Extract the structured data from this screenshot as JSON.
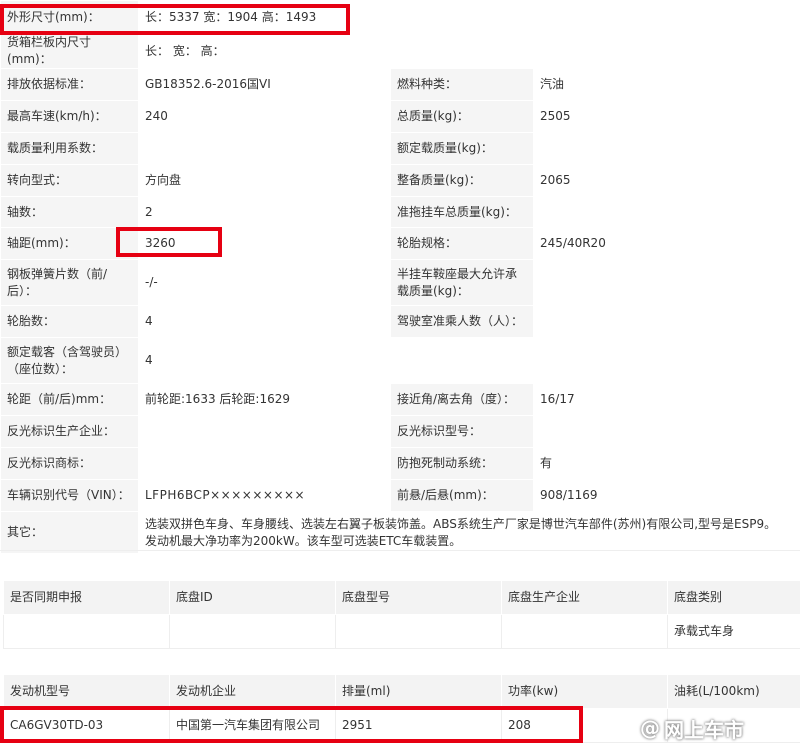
{
  "specs": [
    {
      "label": "外形尺寸(mm)：",
      "value": "长：5337 宽：1904 高：1493"
    },
    {
      "label": "货箱栏板内尺寸(mm)：",
      "value": "长： 宽： 高："
    },
    {
      "label": "排放依据标准：",
      "value": "GB18352.6-2016国VI",
      "label2": "燃料种类：",
      "value2": "汽油"
    },
    {
      "label": "最高车速(km/h)：",
      "value": "240",
      "label2": "总质量(kg)：",
      "value2": "2505"
    },
    {
      "label": "载质量利用系数：",
      "value": "",
      "label2": "额定载质量(kg)：",
      "value2": ""
    },
    {
      "label": "转向型式：",
      "value": "方向盘",
      "label2": "整备质量(kg)：",
      "value2": "2065"
    },
    {
      "label": "轴数：",
      "value": "2",
      "label2": "准拖挂车总质量(kg)：",
      "value2": ""
    },
    {
      "label": "轴距(mm)：",
      "value": "3260",
      "label2": "轮胎规格：",
      "value2": "245/40R20"
    },
    {
      "label": "钢板弹簧片数（前/后）：",
      "value": "-/-",
      "label2": "半挂车鞍座最大允许承载质量(kg)：",
      "value2": ""
    },
    {
      "label": "轮胎数：",
      "value": "4",
      "label2": "驾驶室准乘人数（人）：",
      "value2": ""
    },
    {
      "label": "额定载客（含驾驶员）（座位数）：",
      "value": "4"
    },
    {
      "label": "轮距（前/后)mm：",
      "value": "前轮距:1633 后轮距:1629",
      "label2": "接近角/离去角（度）：",
      "value2": "16/17"
    },
    {
      "label": "反光标识生产企业：",
      "value": "",
      "label2": "反光标识型号：",
      "value2": ""
    },
    {
      "label": "反光标识商标：",
      "value": "",
      "label2": "防抱死制动系统：",
      "value2": "有"
    },
    {
      "label": "车辆识别代号（VIN）：",
      "value": "LFPH6BCP×××××××××",
      "label2": "前悬/后悬(mm)：",
      "value2": "908/1169"
    },
    {
      "label": "其它：",
      "value": "选装双拼色车身、车身腰线、选装左右翼子板装饰盖。ABS系统生产厂家是博世汽车部件(苏州)有限公司,型号是ESP9。发动机最大净功率为200kW。该车型可选装ETC车载装置。"
    }
  ],
  "chassis": {
    "headers": [
      "是否同期申报",
      "底盘ID",
      "底盘型号",
      "底盘生产企业",
      "底盘类别"
    ],
    "row": [
      "",
      "",
      "",
      "",
      "承载式车身"
    ]
  },
  "engine": {
    "headers": [
      "发动机型号",
      "发动机企业",
      "排量(ml)",
      "功率(kw)",
      "油耗(L/100km)"
    ],
    "row": [
      "CA6GV30TD-03",
      "中国第一汽车集团有限公司",
      "2951",
      "208",
      ""
    ]
  },
  "watermark": {
    "symbol": "@",
    "text": "网上车市"
  },
  "colors": {
    "label_bg": "#f5f5f5",
    "highlight": "#e60012"
  }
}
